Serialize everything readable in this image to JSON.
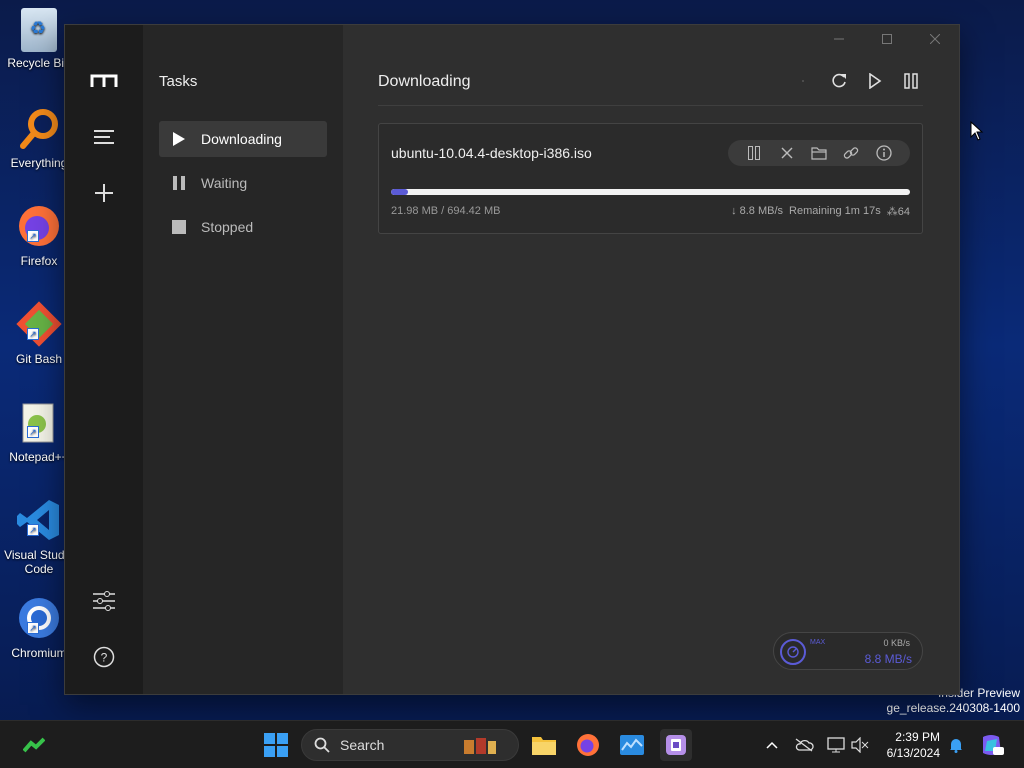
{
  "desktop": {
    "icons": [
      {
        "label": "Recycle Bin",
        "icon": "recycle-bin-icon"
      },
      {
        "label": "Everything",
        "icon": "everything-icon"
      },
      {
        "label": "Firefox",
        "icon": "firefox-icon"
      },
      {
        "label": "Git Bash",
        "icon": "git-bash-icon"
      },
      {
        "label": "Notepad++",
        "icon": "notepad-plus-plus-icon"
      },
      {
        "label": "Visual Studio Code",
        "icon": "vscode-icon"
      },
      {
        "label": "Chromium",
        "icon": "chromium-icon"
      }
    ],
    "watermark_line1": "Insider Preview",
    "watermark_line2": "ge_release.240308-1400"
  },
  "app": {
    "subnav_title": "Tasks",
    "nav": [
      {
        "label": "Downloading",
        "icon": "play-icon",
        "active": true
      },
      {
        "label": "Waiting",
        "icon": "pause-icon",
        "active": false
      },
      {
        "label": "Stopped",
        "icon": "stop-icon",
        "active": false
      }
    ],
    "main_title": "Downloading",
    "task": {
      "name": "ubuntu-10.04.4-desktop-i386.iso",
      "progress": 0.032,
      "size": "21.98 MB / 694.42 MB",
      "speed": "8.8 MB/s",
      "remaining": "Remaining 1m 17s",
      "connections": "64"
    },
    "speed_widget": {
      "max_label": "MAX",
      "upload": "0 KB/s",
      "download": "8.8 MB/s"
    }
  },
  "taskbar": {
    "search_label": "Search",
    "time": "2:39 PM",
    "date": "6/13/2024"
  },
  "colors": {
    "accent": "#5b5bd6"
  }
}
